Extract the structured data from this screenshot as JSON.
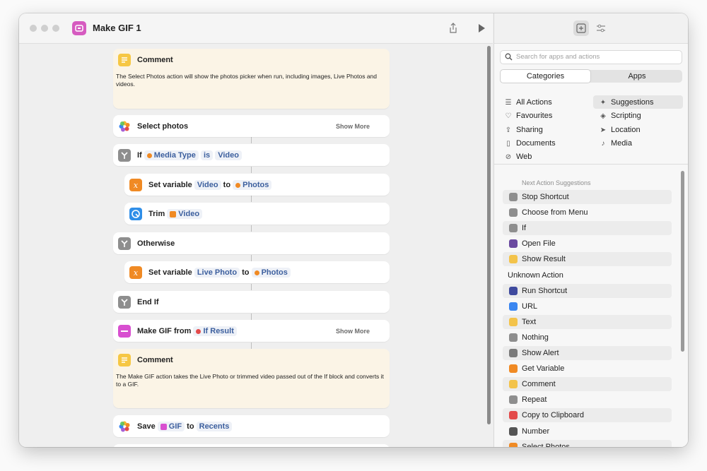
{
  "window": {
    "title": "Make GIF 1"
  },
  "actions": [
    {
      "type": "Comment",
      "title": "Comment",
      "body": "The Select Photos action will show the photos picker when run, including images, Live Photos and videos."
    },
    {
      "title": "Select photos",
      "show_more": "Show More"
    },
    {
      "parts": {
        "if": "If",
        "var": "Media Type",
        "op": "is",
        "val": "Video"
      }
    },
    {
      "parts": {
        "set": "Set variable",
        "var": "Video",
        "to": "to",
        "val": "Photos"
      }
    },
    {
      "parts": {
        "trim": "Trim",
        "val": "Video"
      }
    },
    {
      "title": "Otherwise"
    },
    {
      "parts": {
        "set": "Set variable",
        "var": "Live Photo",
        "to": "to",
        "val": "Photos"
      }
    },
    {
      "title": "End If"
    },
    {
      "parts": {
        "title": "Make GIF from",
        "val": "If Result"
      },
      "show_more": "Show More"
    },
    {
      "type": "Comment",
      "title": "Comment",
      "body": "The Make GIF action takes the Live Photo or trimmed video passed out of the If block and converts it to a GIF."
    },
    {
      "parts": {
        "save": "Save",
        "val": "GIF",
        "to": "to",
        "dest": "Recents"
      }
    }
  ],
  "library": {
    "search_placeholder": "Search for apps and actions",
    "segments": [
      "Categories",
      "Apps"
    ],
    "active_segment": "Categories",
    "categories_left": [
      {
        "label": "All Actions",
        "icon": "list-icon"
      },
      {
        "label": "Favourites",
        "icon": "heart-icon"
      },
      {
        "label": "Sharing",
        "icon": "share-icon"
      },
      {
        "label": "Documents",
        "icon": "document-icon"
      },
      {
        "label": "Web",
        "icon": "compass-icon"
      }
    ],
    "categories_right": [
      {
        "label": "Suggestions",
        "icon": "sparkle-icon"
      },
      {
        "label": "Scripting",
        "icon": "scripting-icon"
      },
      {
        "label": "Location",
        "icon": "location-icon"
      },
      {
        "label": "Media",
        "icon": "music-note-icon"
      }
    ],
    "selected_category": "Suggestions",
    "next_heading": "Next Action Suggestions",
    "suggestions": [
      {
        "label": "Stop Shortcut",
        "color": "#8e8e8e"
      },
      {
        "label": "Choose from Menu",
        "color": "#8e8e8e"
      },
      {
        "label": "If",
        "color": "#8e8e8e"
      },
      {
        "label": "Open File",
        "color": "#6b4aa0"
      },
      {
        "label": "Show Result",
        "color": "#f3c34a"
      },
      {
        "label": "Unknown Action",
        "color": ""
      },
      {
        "label": "Run Shortcut",
        "color": "#3f4a9e"
      },
      {
        "label": "URL",
        "color": "#3a86f0"
      },
      {
        "label": "Text",
        "color": "#f3c34a"
      },
      {
        "label": "Nothing",
        "color": "#8e8e8e"
      },
      {
        "label": "Show Alert",
        "color": "#7a7a7a"
      },
      {
        "label": "Get Variable",
        "color": "#f08a24"
      },
      {
        "label": "Comment",
        "color": "#f3c34a"
      },
      {
        "label": "Repeat",
        "color": "#8e8e8e"
      },
      {
        "label": "Copy to Clipboard",
        "color": "#e34a4a"
      },
      {
        "label": "Number",
        "color": "#555555"
      },
      {
        "label": "Select Photos",
        "color": "#f08a24"
      }
    ]
  }
}
